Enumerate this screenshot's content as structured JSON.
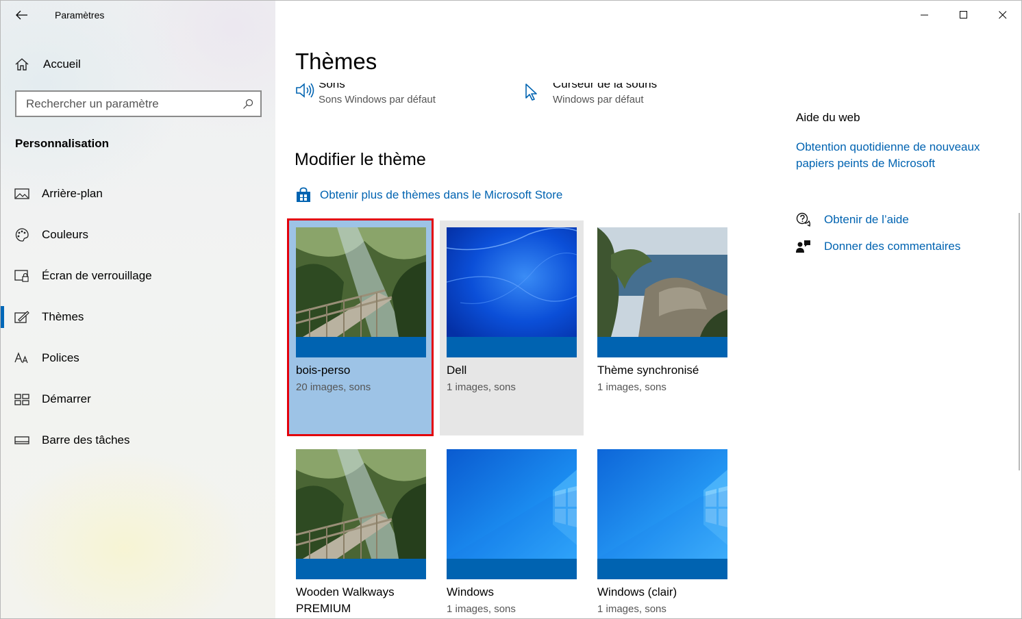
{
  "window": {
    "title": "Paramètres"
  },
  "sidebar": {
    "home_label": "Accueil",
    "search_placeholder": "Rechercher un paramètre",
    "section": "Personnalisation",
    "items": [
      {
        "label": "Arrière-plan",
        "icon": "picture-icon"
      },
      {
        "label": "Couleurs",
        "icon": "palette-icon"
      },
      {
        "label": "Écran de verrouillage",
        "icon": "lock-screen-icon"
      },
      {
        "label": "Thèmes",
        "icon": "themes-icon",
        "active": true
      },
      {
        "label": "Polices",
        "icon": "fonts-icon"
      },
      {
        "label": "Démarrer",
        "icon": "start-icon"
      },
      {
        "label": "Barre des tâches",
        "icon": "taskbar-icon"
      }
    ]
  },
  "main": {
    "title": "Thèmes",
    "props": [
      {
        "title": "Sons",
        "subtitle": "Sons Windows par défaut",
        "icon": "speaker-icon"
      },
      {
        "title": "Curseur de la souris",
        "subtitle": "Windows par défaut",
        "icon": "cursor-icon"
      }
    ],
    "change_theme_title": "Modifier le thème",
    "store_link": "Obtenir plus de thèmes dans le Microsoft Store",
    "themes": [
      {
        "name": "bois-perso",
        "meta": "20 images, sons",
        "state": "selected"
      },
      {
        "name": "Dell",
        "meta": "1 images, sons",
        "state": "hover"
      },
      {
        "name": "Thème synchronisé",
        "meta": "1 images, sons"
      },
      {
        "name": "Wooden Walkways",
        "name2": "PREMIUM"
      },
      {
        "name": "Windows",
        "meta": "1 images, sons"
      },
      {
        "name": "Windows (clair)",
        "meta": "1 images, sons"
      }
    ]
  },
  "help": {
    "title": "Aide du web",
    "web_link_line1": "Obtention quotidienne de nouveaux",
    "web_link_line2": "papiers peints de Microsoft",
    "get_help": "Obtenir de l’aide",
    "feedback": "Donner des commentaires"
  },
  "colors": {
    "accent": "#0063b1",
    "selected_tile": "#9dc3e6",
    "highlight_frame": "#e3000b"
  }
}
